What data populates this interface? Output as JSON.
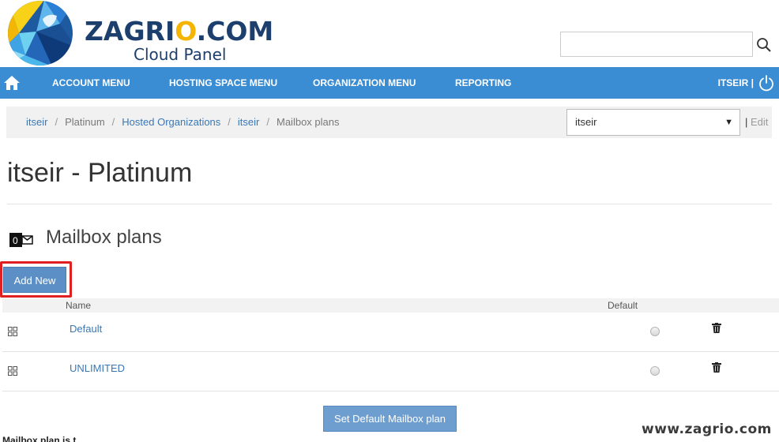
{
  "brand": {
    "name_part1": "ZAGRI",
    "name_accent": "O",
    "name_part2": ".COM",
    "subtitle": "Cloud Panel"
  },
  "search": {
    "placeholder": "",
    "value": ""
  },
  "nav": {
    "items": [
      {
        "label": "ACCOUNT MENU"
      },
      {
        "label": "HOSTING SPACE MENU"
      },
      {
        "label": "ORGANIZATION MENU"
      },
      {
        "label": "REPORTING"
      }
    ],
    "user": "ITSEIR |"
  },
  "breadcrumb": {
    "items": [
      {
        "label": "itseir",
        "link": true
      },
      {
        "label": "Platinum",
        "link": false
      },
      {
        "label": "Hosted Organizations",
        "link": true
      },
      {
        "label": "itseir",
        "link": true
      },
      {
        "label": "Mailbox plans",
        "link": false
      }
    ],
    "separator": "/",
    "org_select_value": "itseir",
    "edit_prefix": "|",
    "edit_label": "Edit"
  },
  "page": {
    "title": "itseir - Platinum"
  },
  "section": {
    "title": "Mailbox plans",
    "icon": "outlook-mail-icon"
  },
  "actions": {
    "add_new": "Add New",
    "set_default": "Set Default Mailbox plan"
  },
  "table": {
    "columns": {
      "name": "Name",
      "default": "Default"
    },
    "rows": [
      {
        "name": "Default"
      },
      {
        "name": "UNLIMITED"
      }
    ]
  },
  "footer": {
    "cutoff_text": "Mailbox plan is t...",
    "watermark": "www.zagrio.com"
  },
  "colors": {
    "nav_bg": "#3a8cd3",
    "brand_navy": "#1d3f6e",
    "brand_accent": "#f5b400",
    "button_bg": "#5b8fc5",
    "highlight": "#e02020",
    "link": "#3a78b5"
  }
}
